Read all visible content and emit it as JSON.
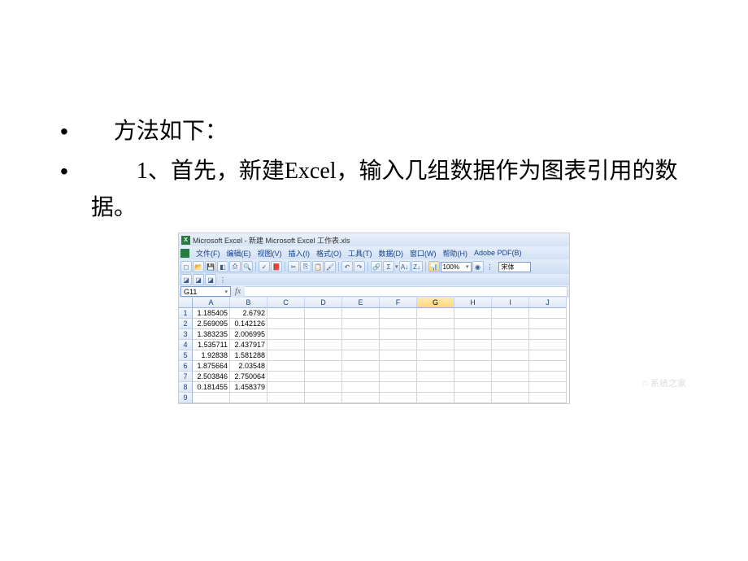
{
  "slide": {
    "bullets": [
      "　方法如下：",
      "　　1、首先，新建Excel，输入几组数据作为图表引用的数据。"
    ]
  },
  "excel": {
    "title": "Microsoft Excel - 新建 Microsoft Excel 工作表.xls",
    "menus": [
      "文件(F)",
      "编辑(E)",
      "视图(V)",
      "插入(I)",
      "格式(O)",
      "工具(T)",
      "数据(D)",
      "窗口(W)",
      "帮助(H)",
      "Adobe PDF(B)"
    ],
    "zoom": "100%",
    "font": "宋体",
    "namebox": "G11",
    "columns": [
      "A",
      "B",
      "C",
      "D",
      "E",
      "F",
      "G",
      "H",
      "I",
      "J"
    ],
    "selected_col": "G",
    "rows": [
      {
        "n": "1",
        "a": "1.185405",
        "b": "2.6792"
      },
      {
        "n": "2",
        "a": "2.569095",
        "b": "0.142126"
      },
      {
        "n": "3",
        "a": "1.383235",
        "b": "2.006995"
      },
      {
        "n": "4",
        "a": "1.535711",
        "b": "2.437917"
      },
      {
        "n": "5",
        "a": "1.92838",
        "b": "1.581288"
      },
      {
        "n": "6",
        "a": "1.875664",
        "b": "2.03548"
      },
      {
        "n": "7",
        "a": "2.503846",
        "b": "2.750064"
      },
      {
        "n": "8",
        "a": "0.181455",
        "b": "1.458379"
      },
      {
        "n": "9",
        "a": "",
        "b": ""
      }
    ],
    "watermark": "系统之家"
  }
}
